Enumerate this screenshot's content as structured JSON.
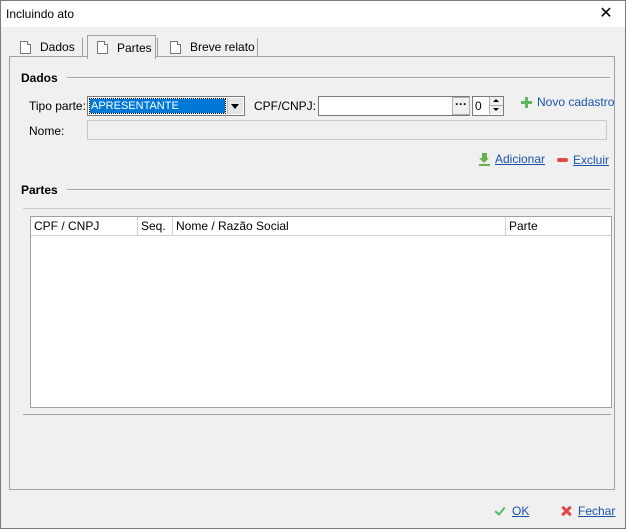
{
  "window": {
    "title": "Incluindo ato",
    "close_glyph": "✕"
  },
  "tabs": [
    {
      "label": "Dados",
      "icon": "document-icon",
      "active": false
    },
    {
      "label": "Partes",
      "icon": "document-icon",
      "active": true
    },
    {
      "label": "Breve relato",
      "icon": "document-icon",
      "active": false
    }
  ],
  "dados": {
    "section_title": "Dados",
    "tipo_parte_label": "Tipo parte:",
    "tipo_parte_value": "APRESENTANTE",
    "cpf_label": "CPF/CNPJ:",
    "cpf_value": "",
    "ellipsis": "···",
    "seq_value": "0",
    "novo_cadastro": "Novo cadastro",
    "nome_label": "Nome:",
    "nome_value": "",
    "adicionar": "Adicionar",
    "excluir": "Excluir"
  },
  "partes": {
    "section_title": "Partes",
    "columns": [
      "CPF / CNPJ",
      "Seq.",
      "Nome / Razão Social",
      "Parte"
    ],
    "rows": []
  },
  "footer": {
    "ok": "OK",
    "fechar": "Fechar"
  },
  "colors": {
    "link": "#1a54a8",
    "selection": "#0078d7",
    "add": "#5cb85c",
    "remove": "#e04848"
  }
}
